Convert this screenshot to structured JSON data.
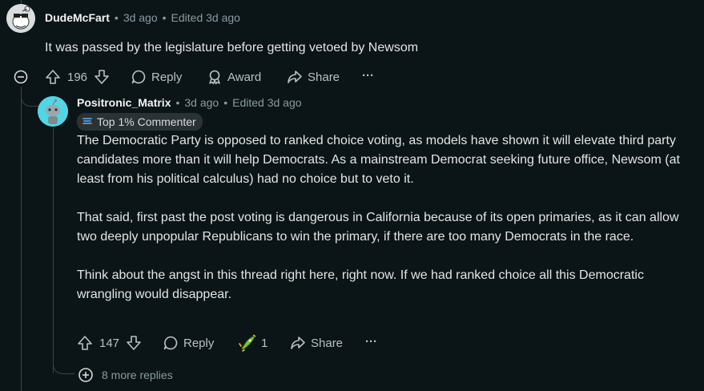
{
  "comment1": {
    "author": "DudeMcFart",
    "time": "3d ago",
    "edited": "Edited 3d ago",
    "text": "It was passed by the legislature before getting vetoed by Newsom",
    "votes": "196",
    "reply_label": "Reply",
    "award_label": "Award",
    "share_label": "Share",
    "more_label": "···"
  },
  "comment2": {
    "author": "Positronic_Matrix",
    "time": "3d ago",
    "edited": "Edited 3d ago",
    "flair": "Top 1% Commenter",
    "paragraphs": [
      "The Democratic Party is opposed to ranked choice voting, as models have shown it will elevate third party candidates more than it will help Democrats. As a mainstream Democrat seeking future office, Newsom (at least from his political calculus) had no choice but to veto it.",
      "That said, first past the post voting is dangerous in California because of its open primaries, as it can allow two deeply unpopular Republicans to win the primary, if there are too many Democrats in the race.",
      "Think about the angst in this thread right here, right now. If we had ranked choice all this Democratic wrangling would disappear."
    ],
    "votes": "147",
    "reply_label": "Reply",
    "award_count": "1",
    "share_label": "Share",
    "more_label": "···"
  },
  "more_replies": "8 more replies",
  "separator": "•"
}
